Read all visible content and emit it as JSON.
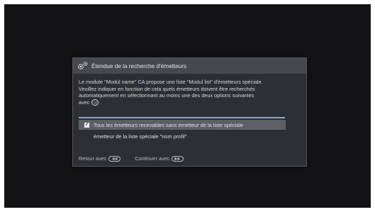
{
  "dialog": {
    "title": "Étendue de la recherche d'émetteurs",
    "description_lines": [
      "Le module \"Modul name\" CA propose une liste \"Modul list\" d'émetteurs spéciale.",
      "Veuillez indiquer en fonction de cela quels émetteurs doivent être recherchés",
      "automatiquement en sélectionnant au moins une des deux options suivantes",
      "avec"
    ],
    "description_end": ".",
    "options": [
      {
        "label": "Tous les émetteurs recevables sans émetteur de la liste spéciale",
        "checked": true,
        "highlighted": true
      },
      {
        "label": "émetteur de la liste spéciale \"nom profil\"",
        "checked": false,
        "highlighted": false
      }
    ],
    "footer": {
      "back_label": "Retour avec",
      "continue_label": "Continuer avec"
    }
  },
  "icons": {
    "title_icon": "gears-icon",
    "ok_button_icon": "ok-button-icon",
    "back_button_icon": "rewind-button-icon",
    "continue_button_icon": "fast-forward-button-icon"
  },
  "colors": {
    "screen_background": "#131316",
    "dialog_background": "#2c2f33",
    "title_bar": "#45484d",
    "highlight_row": "#5c5f66",
    "separator_accent": "#8faacc"
  }
}
